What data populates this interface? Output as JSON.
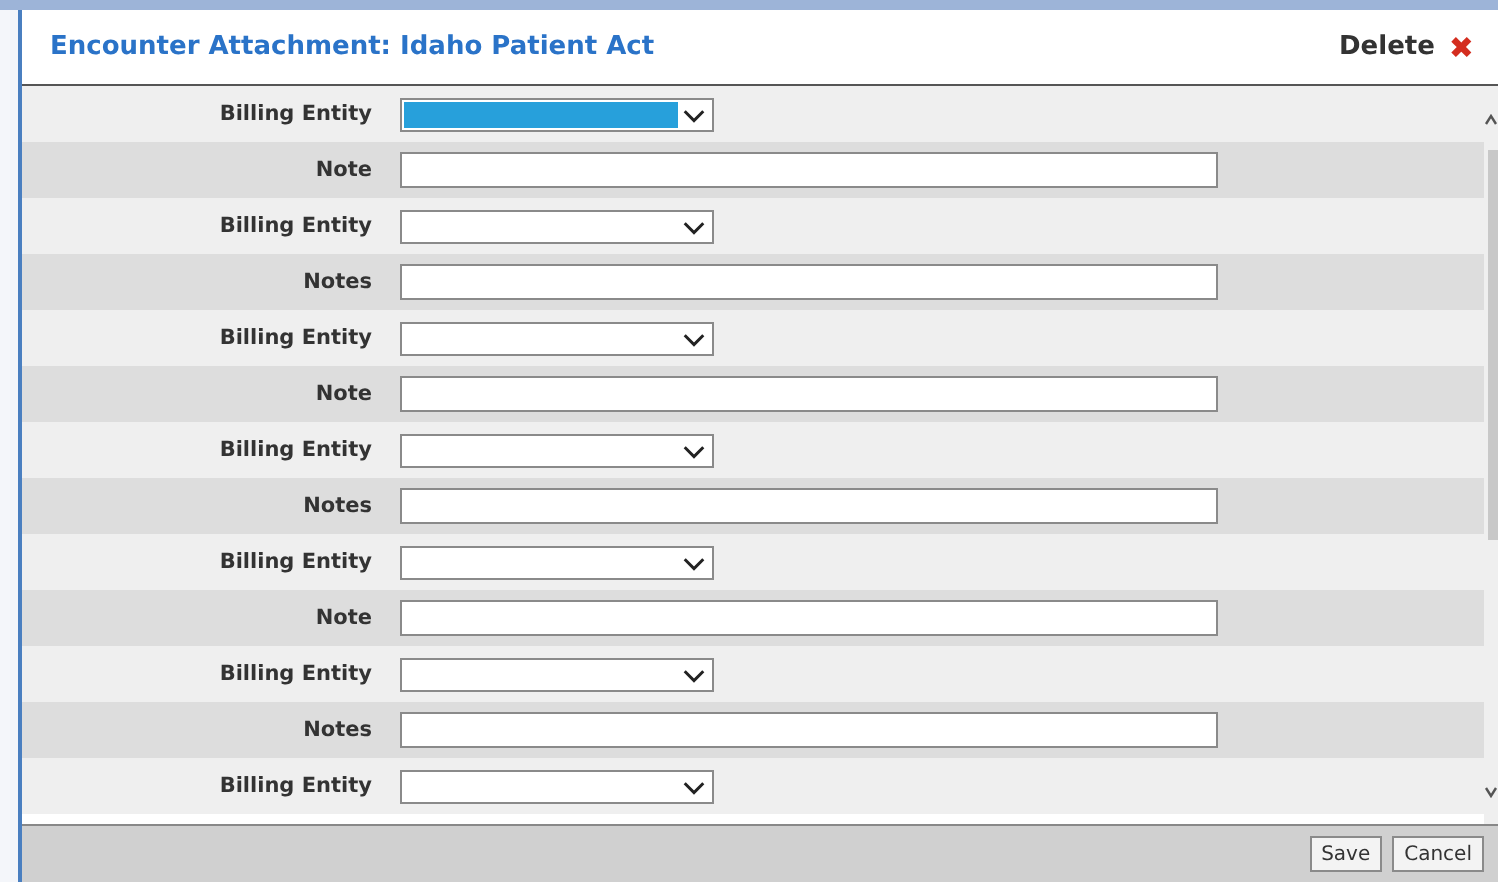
{
  "dialog": {
    "title": "Encounter Attachment: Idaho Patient Act",
    "delete_label": "Delete",
    "delete_icon": "✖"
  },
  "rows": [
    {
      "label": "Billing Entity",
      "kind": "select",
      "focused": true
    },
    {
      "label": "Note",
      "kind": "text",
      "focused": false
    },
    {
      "label": "Billing Entity",
      "kind": "select",
      "focused": false
    },
    {
      "label": "Notes",
      "kind": "text",
      "focused": false
    },
    {
      "label": "Billing Entity",
      "kind": "select",
      "focused": false
    },
    {
      "label": "Note",
      "kind": "text",
      "focused": false
    },
    {
      "label": "Billing Entity",
      "kind": "select",
      "focused": false
    },
    {
      "label": "Notes",
      "kind": "text",
      "focused": false
    },
    {
      "label": "Billing Entity",
      "kind": "select",
      "focused": false
    },
    {
      "label": "Note",
      "kind": "text",
      "focused": false
    },
    {
      "label": "Billing Entity",
      "kind": "select",
      "focused": false
    },
    {
      "label": "Notes",
      "kind": "text",
      "focused": false
    },
    {
      "label": "Billing Entity",
      "kind": "select",
      "focused": false
    }
  ],
  "buttons": [
    "Save",
    "Cancel"
  ]
}
